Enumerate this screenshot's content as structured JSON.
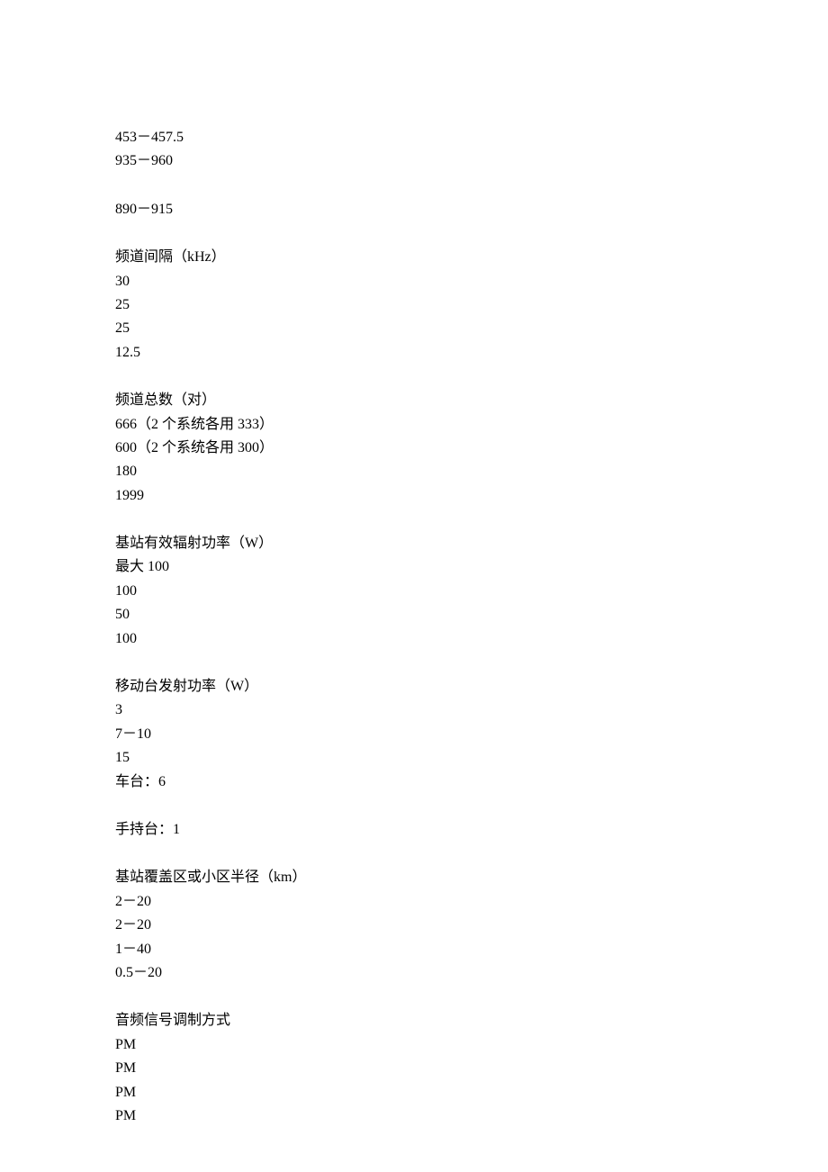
{
  "sections": [
    {
      "lines": [
        "453－457.5",
        "935－960"
      ]
    },
    {
      "lines": [
        "890－915"
      ]
    },
    {
      "lines": [
        "频道间隔（kHz）",
        "30",
        "25",
        "25",
        "12.5"
      ]
    },
    {
      "lines": [
        "频道总数（对）",
        "666（2 个系统各用 333）",
        "600（2 个系统各用 300）",
        "180",
        "1999"
      ]
    },
    {
      "lines": [
        "基站有效辐射功率（W）",
        "最大 100",
        "100",
        "50",
        "100"
      ]
    },
    {
      "lines": [
        "移动台发射功率（W）",
        "3",
        "7－10",
        "15",
        "车台：6"
      ]
    },
    {
      "lines": [
        "手持台：1"
      ]
    },
    {
      "lines": [
        "基站覆盖区或小区半径（km）",
        "2－20",
        "2－20",
        "1－40",
        "0.5－20"
      ]
    },
    {
      "lines": [
        "音频信号调制方式",
        "PM",
        "PM",
        "PM",
        "PM"
      ]
    }
  ]
}
